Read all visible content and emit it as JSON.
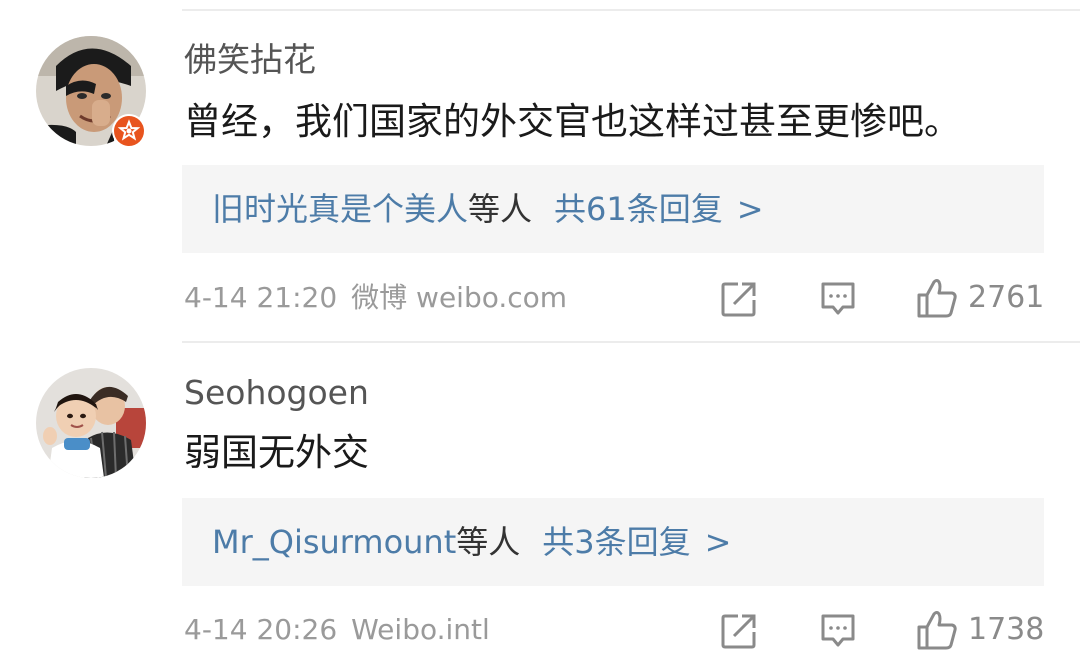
{
  "comments": [
    {
      "username": "佛笑拈花",
      "content": "曾经，我们国家的外交官也这样过甚至更惨吧。",
      "reply": {
        "names": "旧时光真是个美人",
        "suffix": "等人",
        "count_text": "共61条回复",
        "chevron": ">"
      },
      "time": "4-14 21:20",
      "source": "微博 weibo.com",
      "likes": "2761",
      "avatar_icon": "man-smiling-avatar",
      "badge_icon": "vip-badge-icon"
    },
    {
      "username": "Seohogoen",
      "content": "弱国无外交",
      "reply": {
        "names": "Mr_Qisurmount",
        "suffix": "等人",
        "count_text": "共3条回复",
        "chevron": ">"
      },
      "time": "4-14 20:26",
      "source": "Weibo.intl",
      "likes": "1738",
      "avatar_icon": "two-people-avatar"
    }
  ],
  "icons": {
    "share": "share-icon",
    "comment": "comment-icon",
    "like": "thumbs-up-icon"
  },
  "colors": {
    "link_blue": "#4d7ca8",
    "reply_bg": "#f5f5f5",
    "meta_gray": "#9a9a9a",
    "badge_red": "#e8541e"
  }
}
